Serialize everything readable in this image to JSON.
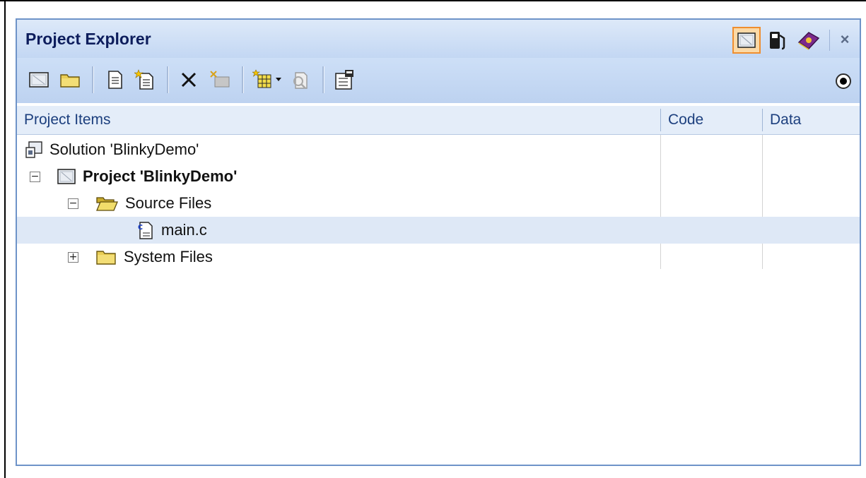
{
  "panel": {
    "title": "Project Explorer",
    "close_label": "×",
    "view_buttons": [
      {
        "icon": "project-view-icon",
        "active": true
      },
      {
        "icon": "fuel-pump-icon",
        "active": false
      },
      {
        "icon": "help-book-icon",
        "active": false
      }
    ]
  },
  "toolbar": {
    "buttons": [
      "new-project-icon",
      "open-folder-icon",
      "new-file-icon",
      "add-existing-file-icon",
      "delete-icon",
      "build-icon",
      "add-items-icon",
      "dropdown-arrow-icon",
      "properties-icon",
      "settings-icon"
    ],
    "radio_icon": "radio-selected-icon"
  },
  "columns": {
    "items": "Project Items",
    "code": "Code",
    "data": "Data"
  },
  "tree": [
    {
      "label": "Solution 'BlinkyDemo'",
      "icon": "solution-icon",
      "level": 0,
      "toggle": null,
      "bold": false
    },
    {
      "label": "Project 'BlinkyDemo'",
      "icon": "project-icon",
      "level": 1,
      "toggle": "−",
      "bold": true
    },
    {
      "label": "Source Files",
      "icon": "open-folder-icon",
      "level": 2,
      "toggle": "−",
      "bold": false
    },
    {
      "label": "main.c",
      "icon": "c-file-icon",
      "level": 3,
      "toggle": null,
      "bold": false,
      "selected": true
    },
    {
      "label": "System Files",
      "icon": "folder-icon",
      "level": 2,
      "toggle": "+",
      "bold": false
    }
  ],
  "colors": {
    "panel_border": "#6e93c8",
    "title_text": "#0d1d5c",
    "header_text": "#1c3f7e",
    "selection": "#dee8f6",
    "active_button": "#fbd9a6"
  }
}
